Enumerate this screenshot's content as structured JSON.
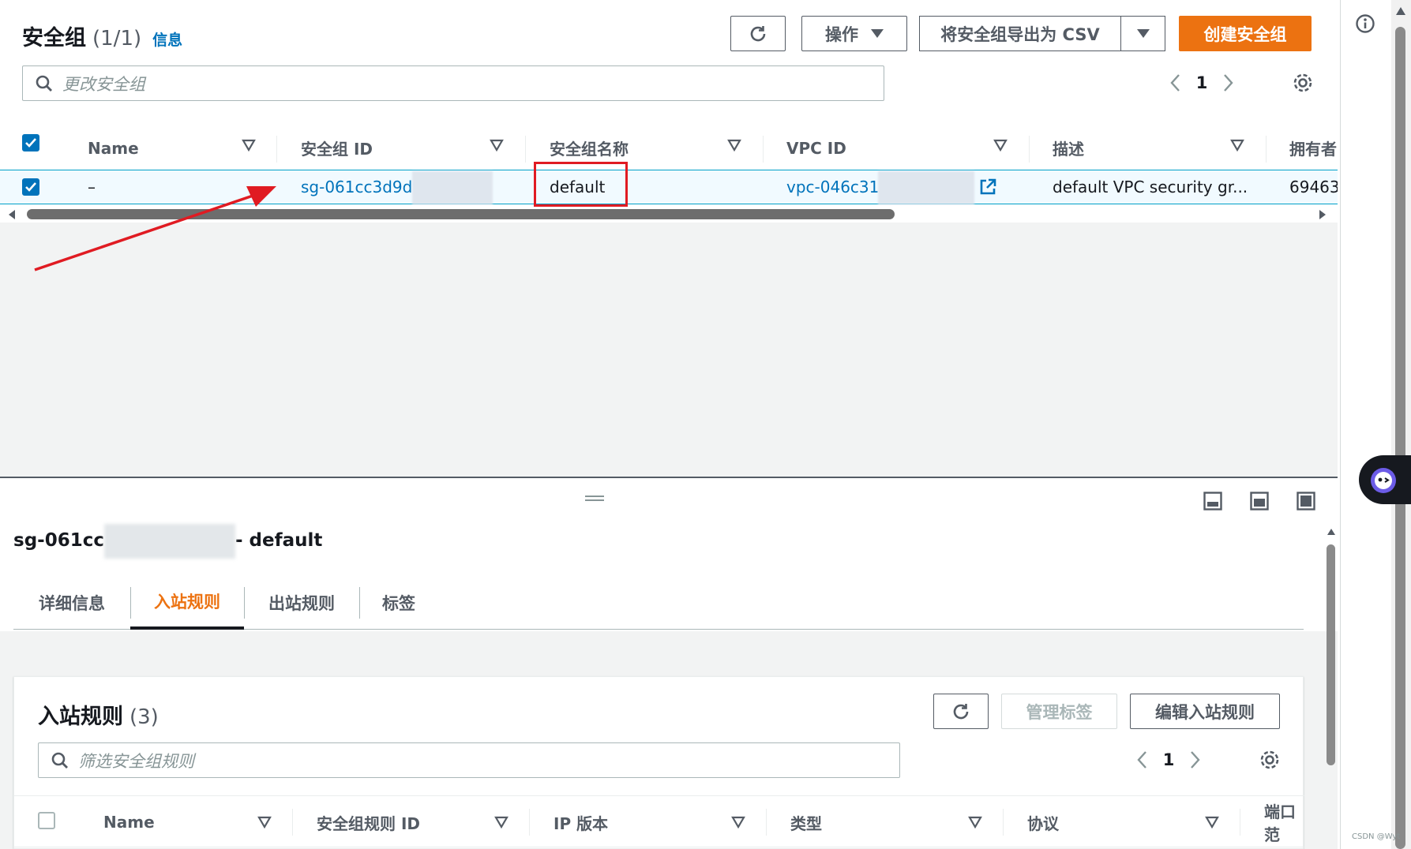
{
  "header": {
    "title": "安全组",
    "count": "(1/1)",
    "info_link": "信息",
    "actions_label": "操作",
    "export_label": "将安全组导出为 CSV",
    "create_label": "创建安全组",
    "search_placeholder": "更改安全组",
    "page": "1"
  },
  "sg_table": {
    "columns": [
      "Name",
      "安全组 ID",
      "安全组名称",
      "VPC ID",
      "描述",
      "拥有者"
    ],
    "rows": [
      {
        "name": "–",
        "sg_id": "sg-061cc3d9d9",
        "sg_name": "default",
        "vpc_id": "vpc-046c315",
        "description": "default VPC security gr...",
        "owner": "69463"
      }
    ]
  },
  "detail": {
    "title_prefix": "sg-061cc",
    "title_suffix": " - default",
    "tabs": [
      "详细信息",
      "入站规则",
      "出站规则",
      "标签"
    ],
    "active_tab": "入站规则"
  },
  "inbound": {
    "title": "入站规则",
    "count": "(3)",
    "manage_tags_label": "管理标签",
    "edit_label": "编辑入站规则",
    "search_placeholder": "筛选安全组规则",
    "page": "1",
    "columns": [
      "Name",
      "安全组规则 ID",
      "IP 版本",
      "类型",
      "协议",
      "端口范"
    ]
  },
  "footer": {
    "watermark": "CSDN @Wyt"
  },
  "colors": {
    "primary": "#ec7211",
    "link": "#0073bb",
    "annotation": "#e01b22",
    "selected_row": "#f1faff"
  }
}
